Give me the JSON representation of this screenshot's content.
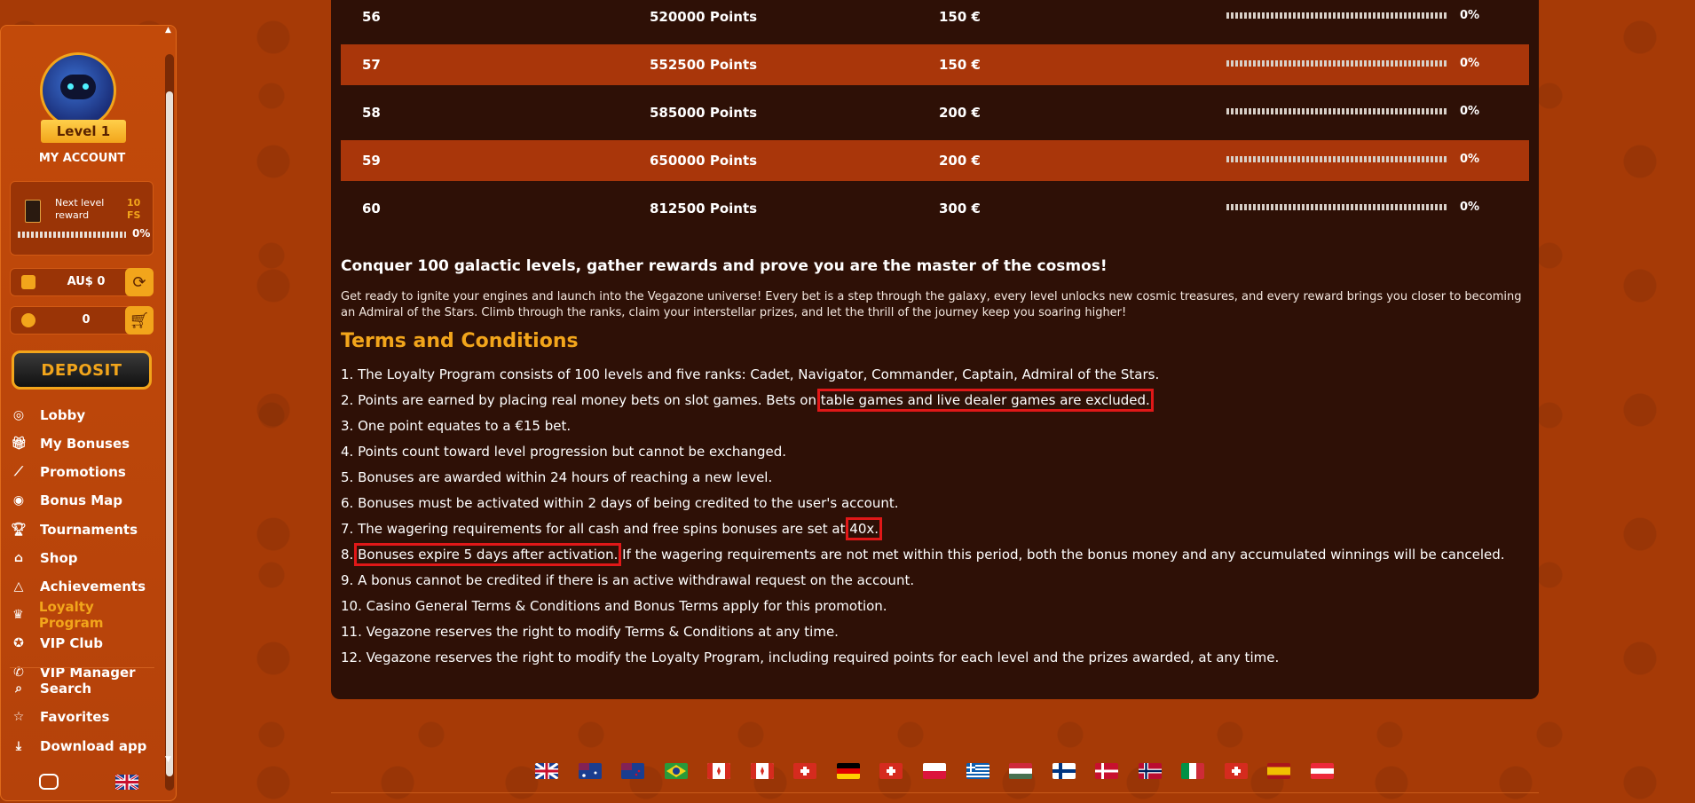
{
  "sidebar": {
    "level_label": "Level 1",
    "my_account": "MY ACCOUNT",
    "next_reward_label": "Next level reward",
    "next_reward_value": "10 FS",
    "next_reward_percent": "0%",
    "balance": "AU$ 0",
    "coins": "0",
    "deposit_label": "DEPOSIT",
    "nav_primary": [
      {
        "label": "Lobby",
        "icon": "lobby-icon"
      },
      {
        "label": "My Bonuses",
        "icon": "gift-icon"
      },
      {
        "label": "Promotions",
        "icon": "telescope-icon"
      },
      {
        "label": "Bonus Map",
        "icon": "map-icon"
      },
      {
        "label": "Tournaments",
        "icon": "trophy-icon"
      },
      {
        "label": "Shop",
        "icon": "shop-icon"
      },
      {
        "label": "Achievements",
        "icon": "achievements-icon"
      },
      {
        "label": "Loyalty Program",
        "icon": "crown-icon",
        "active": true
      },
      {
        "label": "VIP Club",
        "icon": "vip-icon"
      },
      {
        "label": "VIP Manager",
        "icon": "whatsapp-icon"
      }
    ],
    "nav_secondary": [
      {
        "label": "Search",
        "icon": "search-icon"
      },
      {
        "label": "Favorites",
        "icon": "star-icon"
      },
      {
        "label": "Download app",
        "icon": "download-icon"
      }
    ]
  },
  "levels_table": [
    {
      "level": "56",
      "points": "520000 Points",
      "reward": "150 €",
      "progress": 0,
      "percent": "0%"
    },
    {
      "level": "57",
      "points": "552500 Points",
      "reward": "150 €",
      "progress": 0,
      "percent": "0%"
    },
    {
      "level": "58",
      "points": "585000 Points",
      "reward": "200 €",
      "progress": 0,
      "percent": "0%"
    },
    {
      "level": "59",
      "points": "650000 Points",
      "reward": "200 €",
      "progress": 0,
      "percent": "0%"
    },
    {
      "level": "60",
      "points": "812500 Points",
      "reward": "300 €",
      "progress": 0,
      "percent": "0%"
    }
  ],
  "content": {
    "headline": "Conquer 100 galactic levels, gather rewards and prove you are the master of the cosmos!",
    "intro": "Get ready to ignite your engines and launch into the Vegazone universe! Every bet is a step through the galaxy, every level unlocks new cosmic treasures, and every reward brings you closer to becoming an Admiral of the Stars. Climb through the ranks, claim your interstellar prizes, and let the thrill of the journey keep you soaring higher!",
    "terms_title": "Terms and Conditions",
    "terms": {
      "t1": "1. The Loyalty Program consists of 100 levels and five ranks: Cadet, Navigator, Commander, Captain, Admiral of the Stars.",
      "t2_pre": "2. Points are earned by placing real money bets on slot games. Bets on ",
      "t2_hl": "table games and live dealer games are excluded.",
      "t3": "3. One point equates to a €15 bet.",
      "t4": "4. Points count toward level progression but cannot be exchanged.",
      "t5": "5. Bonuses are awarded within 24 hours of reaching a new level.",
      "t6": "6. Bonuses must be activated within 2 days of being credited to the user's account.",
      "t7_pre": "7. The wagering requirements for all cash and free spins bonuses are set at ",
      "t7_hl": "40x.",
      "t8_pre": "8. ",
      "t8_hl": "Bonuses expire 5 days after activation.",
      "t8_post": " If the wagering requirements are not met within this period, both the bonus money and any accumulated winnings will be canceled.",
      "t9": "9. A bonus cannot be credited if there is an active withdrawal request on the account.",
      "t10": "10. Casino General Terms & Conditions and Bonus Terms apply for this promotion.",
      "t11": "11. Vegazone reserves the right to modify Terms & Conditions at any time.",
      "t12": "12. Vegazone reserves the right to modify the Loyalty Program, including required points for each level and the prizes awarded, at any time."
    }
  },
  "footer_flags": [
    "uk-flag",
    "australia-flag",
    "new-zealand-flag",
    "brazil-flag",
    "canada-flag",
    "canada-fr-flag",
    "switzerland-flag",
    "germany-flag",
    "switzerland-de-flag",
    "poland-flag",
    "greece-flag",
    "hungary-flag",
    "finland-flag",
    "denmark-flag",
    "norway-flag",
    "italy-flag",
    "switzerland-it-flag",
    "spain-flag",
    "austria-flag"
  ]
}
